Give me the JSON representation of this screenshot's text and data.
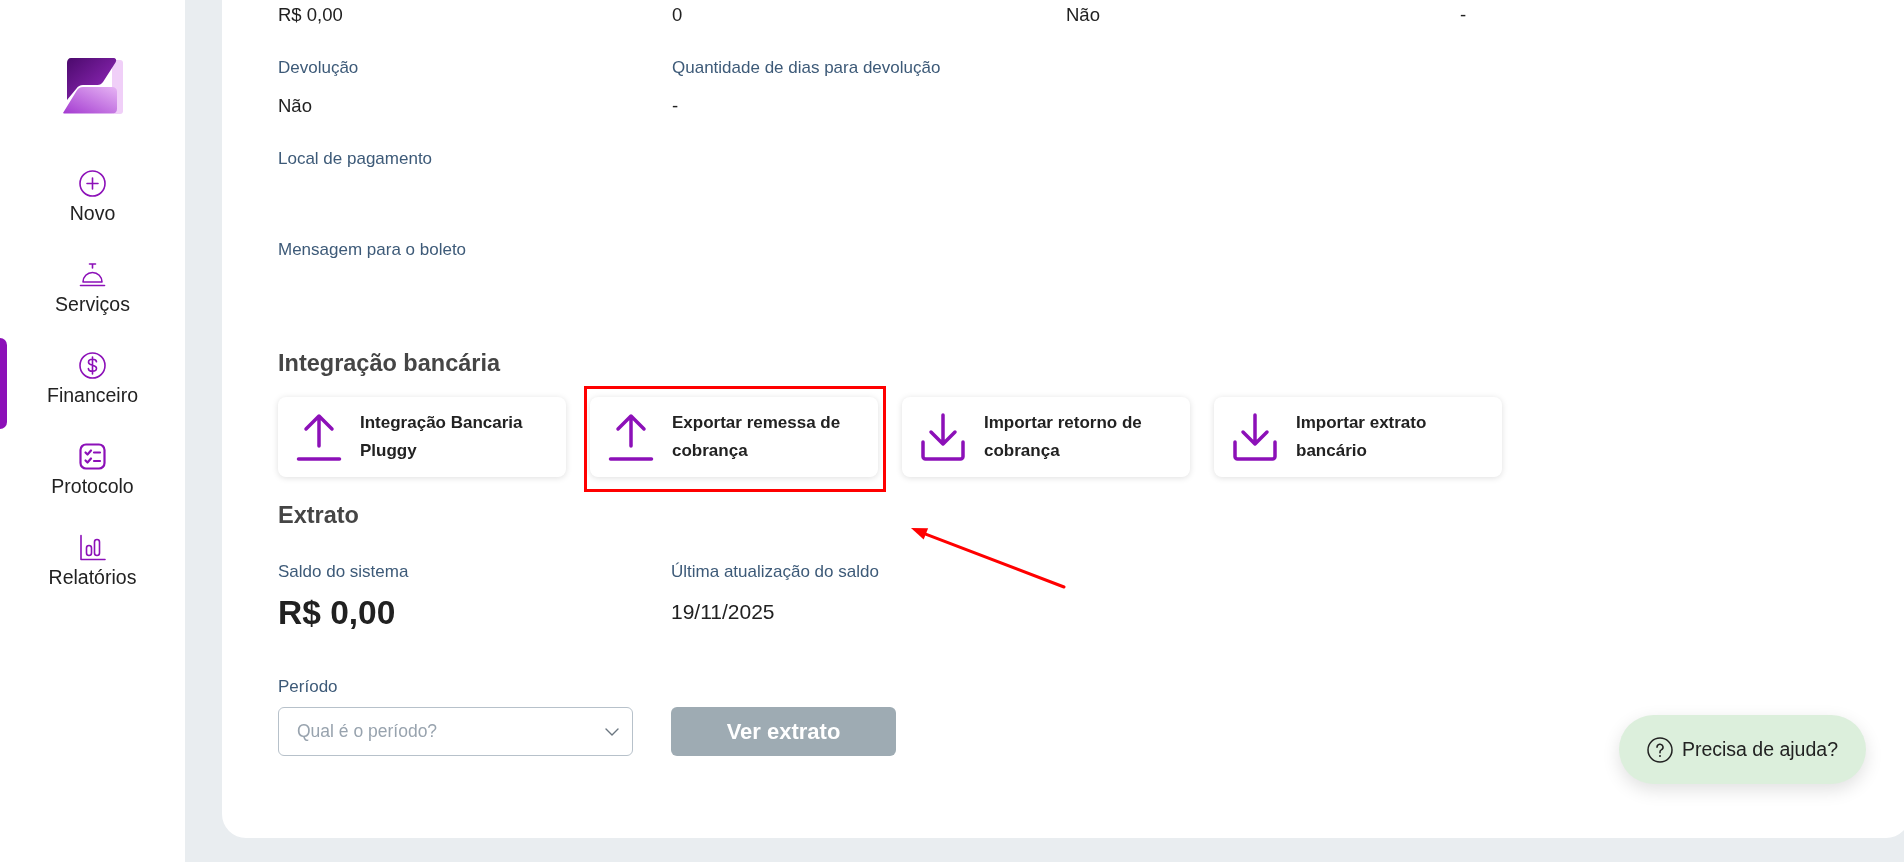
{
  "sidebar": {
    "items": [
      {
        "label": "Novo",
        "selected": false
      },
      {
        "label": "Serviços",
        "selected": false
      },
      {
        "label": "Financeiro",
        "selected": true
      },
      {
        "label": "Protocolo",
        "selected": false
      },
      {
        "label": "Relatórios",
        "selected": false
      }
    ]
  },
  "details": {
    "rows": [
      {
        "fields": [
          {
            "value": "R$ 0,00"
          },
          {
            "value": "0"
          },
          {
            "value": "Não"
          },
          {
            "value": "-"
          }
        ]
      },
      {
        "fields": [
          {
            "label": "Devolução",
            "value": "Não"
          },
          {
            "label": "Quantidade de dias para devolução",
            "value": "-"
          }
        ]
      },
      {
        "fields": [
          {
            "label": "Local de pagamento"
          }
        ]
      },
      {
        "fields": [
          {
            "label": "Mensagem para o boleto"
          }
        ]
      }
    ]
  },
  "integration": {
    "title": "Integração bancária",
    "cards": [
      {
        "kind": "upload",
        "label": "Integração Bancaria Pluggy",
        "highlighted": false
      },
      {
        "kind": "upload",
        "label": "Exportar remessa de cobrança",
        "highlighted": true
      },
      {
        "kind": "download",
        "label": "Importar retorno de cobrança",
        "highlighted": false
      },
      {
        "kind": "download",
        "label": "Importar extrato bancário",
        "highlighted": false
      }
    ]
  },
  "extrato": {
    "title": "Extrato",
    "balance_label": "Saldo do sistema",
    "balance": "R$ 0,00",
    "updated_label": "Última atualização do saldo",
    "updated": "19/11/2025",
    "period": {
      "label": "Período",
      "placeholder": "Qual é o período?"
    },
    "view_button": {
      "label": "Ver extrato",
      "disabled": true
    }
  },
  "help_button": {
    "label": "Precisa de ajuda?"
  }
}
